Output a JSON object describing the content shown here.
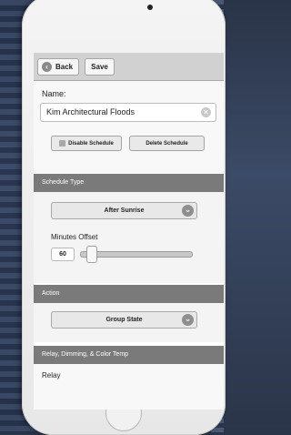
{
  "toolbar": {
    "back_label": "Back",
    "save_label": "Save"
  },
  "schedule": {
    "name_label": "Name:",
    "name_value": "Kim Architectural Floods",
    "disable_label": "Disable Schedule",
    "delete_label": "Delete Schedule"
  },
  "schedule_type": {
    "header": "Schedule Type",
    "selected": "After Sunrise",
    "offset_label": "Minutes Offset",
    "offset_value": "60"
  },
  "action": {
    "header": "Action",
    "selected": "Group State"
  },
  "relay": {
    "header": "Relay, Dimming, & Color Temp",
    "label": "Relay"
  },
  "icons": {
    "back": "arrow-left-icon",
    "clear": "close-icon",
    "chevron": "chevron-down-icon"
  }
}
